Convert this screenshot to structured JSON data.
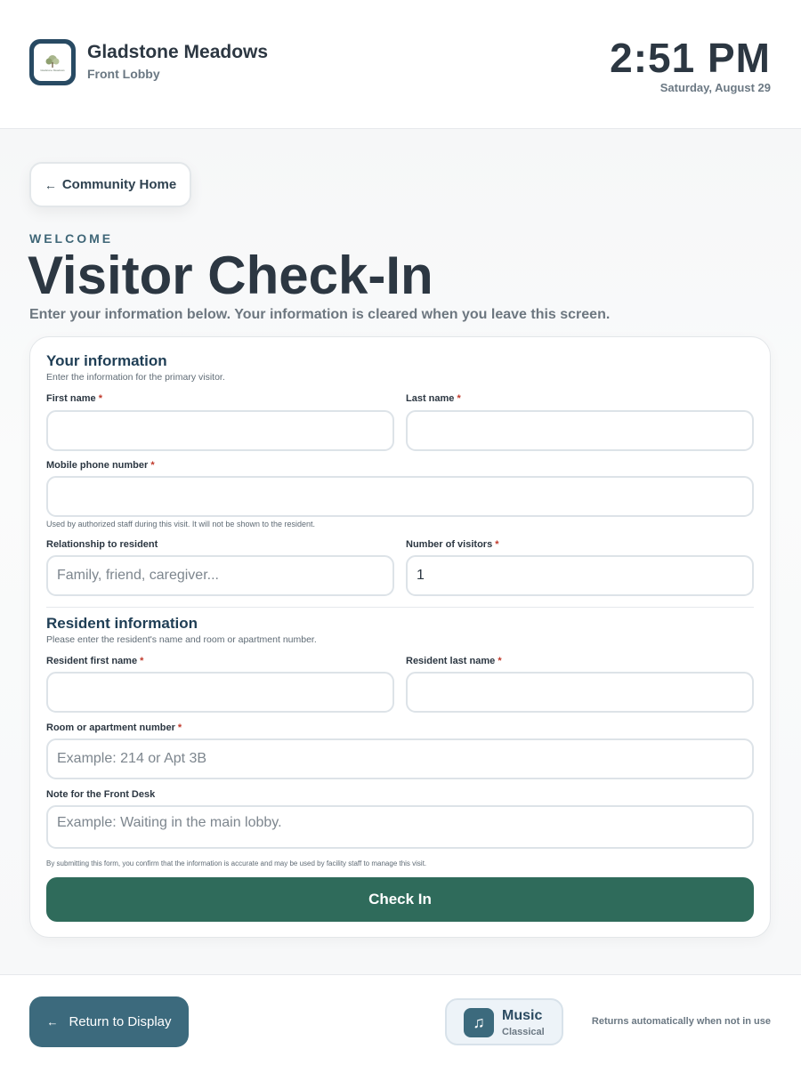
{
  "header": {
    "logo_text": "Gladstone Meadows",
    "community_name": "Gladstone Meadows",
    "location": "Front Lobby",
    "time": "2:51 PM",
    "date": "Saturday, August 29"
  },
  "nav": {
    "home_label": "Community Home",
    "back_arrow": "←"
  },
  "page": {
    "eyebrow": "WELCOME",
    "title": "Visitor Check-In",
    "subtitle": "Enter your information below. Your information is cleared when you leave this screen."
  },
  "form": {
    "visitor_section": {
      "title": "Your information",
      "description": "Enter the information for the primary visitor.",
      "first_name_label": "First name",
      "first_name_value": "",
      "last_name_label": "Last name",
      "last_name_value": "",
      "phone_label": "Mobile phone number",
      "phone_value": "",
      "phone_hint": "Used by authorized staff during this visit. It will not be shown to the resident.",
      "relationship_label": "Relationship to resident",
      "relationship_placeholder": "Family, friend, caregiver...",
      "visitors_label": "Number of visitors",
      "visitors_value": "1"
    },
    "resident_section": {
      "title": "Resident information",
      "description": "Please enter the resident's name and room or apartment number.",
      "first_name_label": "Resident first name",
      "first_name_value": "",
      "last_name_label": "Resident last name",
      "last_name_value": "",
      "room_label": "Room or apartment number",
      "room_placeholder": "Example: 214 or Apt 3B",
      "note_label": "Note for the Front Desk",
      "note_placeholder": "Example: Waiting in the main lobby."
    },
    "required_mark": "*",
    "disclaimer": "By submitting this form, you confirm that the information is accurate and may be used by facility staff to manage this visit.",
    "submit_label": "Check In"
  },
  "footer": {
    "return_label": "Return to Display",
    "return_arrow": "←",
    "music_title": "Music",
    "music_genre": "Classical",
    "music_icon": "♫",
    "auto_return_note": "Returns automatically when not in use"
  },
  "colors": {
    "primary_green": "#2f6b5b",
    "teal_blue": "#3c6a7d",
    "navy": "#284a63",
    "required_red": "#c0392b"
  }
}
